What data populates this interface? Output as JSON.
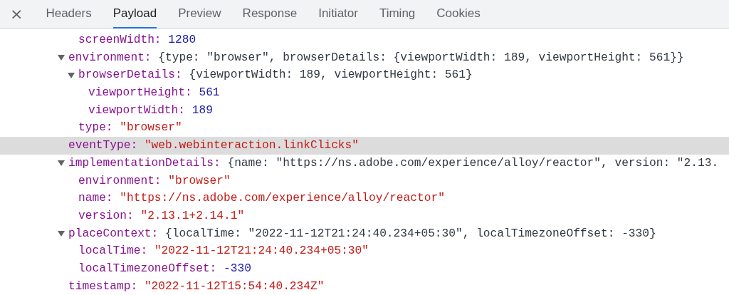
{
  "close_symbol": "×",
  "tabs": [
    {
      "label": "Headers",
      "selected": false
    },
    {
      "label": "Payload",
      "selected": true
    },
    {
      "label": "Preview",
      "selected": false
    },
    {
      "label": "Response",
      "selected": false
    },
    {
      "label": "Initiator",
      "selected": false
    },
    {
      "label": "Timing",
      "selected": false
    },
    {
      "label": "Cookies",
      "selected": false
    }
  ],
  "tree": [
    {
      "children": [
        {
          "key": "screenWidth:",
          "value": "1280",
          "kind": "number",
          "selected": false
        }
      ]
    },
    {
      "key": "environment:",
      "value": "{type: \"browser\", browserDetails: {viewportWidth: 189, viewportHeight: 561}}",
      "kind": "object",
      "expanded": true,
      "selected": false,
      "children": [
        {
          "key": "browserDetails:",
          "value": "{viewportWidth: 189, viewportHeight: 561}",
          "kind": "object",
          "expanded": true,
          "selected": false,
          "children": [
            {
              "key": "viewportHeight:",
              "value": "561",
              "kind": "number",
              "selected": false
            },
            {
              "key": "viewportWidth:",
              "value": "189",
              "kind": "number",
              "selected": false
            }
          ]
        },
        {
          "key": "type:",
          "value": "\"browser\"",
          "kind": "string",
          "selected": false
        }
      ]
    },
    {
      "key": "eventType:",
      "value": "\"web.webinteraction.linkClicks\"",
      "kind": "string",
      "selected": true
    },
    {
      "key": "implementationDetails:",
      "value": "{name: \"https://ns.adobe.com/experience/alloy/reactor\", version: \"2.13.",
      "kind": "object",
      "expanded": true,
      "selected": false,
      "children": [
        {
          "key": "environment:",
          "value": "\"browser\"",
          "kind": "string",
          "selected": false
        },
        {
          "key": "name:",
          "value": "\"https://ns.adobe.com/experience/alloy/reactor\"",
          "kind": "string",
          "selected": false
        },
        {
          "key": "version:",
          "value": "\"2.13.1+2.14.1\"",
          "kind": "string",
          "selected": false
        }
      ]
    },
    {
      "key": "placeContext:",
      "value": "{localTime: \"2022-11-12T21:24:40.234+05:30\", localTimezoneOffset: -330}",
      "kind": "object",
      "expanded": true,
      "selected": false,
      "children": [
        {
          "key": "localTime:",
          "value": "\"2022-11-12T21:24:40.234+05:30\"",
          "kind": "string",
          "selected": false
        },
        {
          "key": "localTimezoneOffset:",
          "value": "-330",
          "kind": "number",
          "selected": false
        }
      ]
    },
    {
      "key": "timestamp:",
      "value": "\"2022-11-12T15:54:40.234Z\"",
      "kind": "string",
      "selected": false
    }
  ]
}
